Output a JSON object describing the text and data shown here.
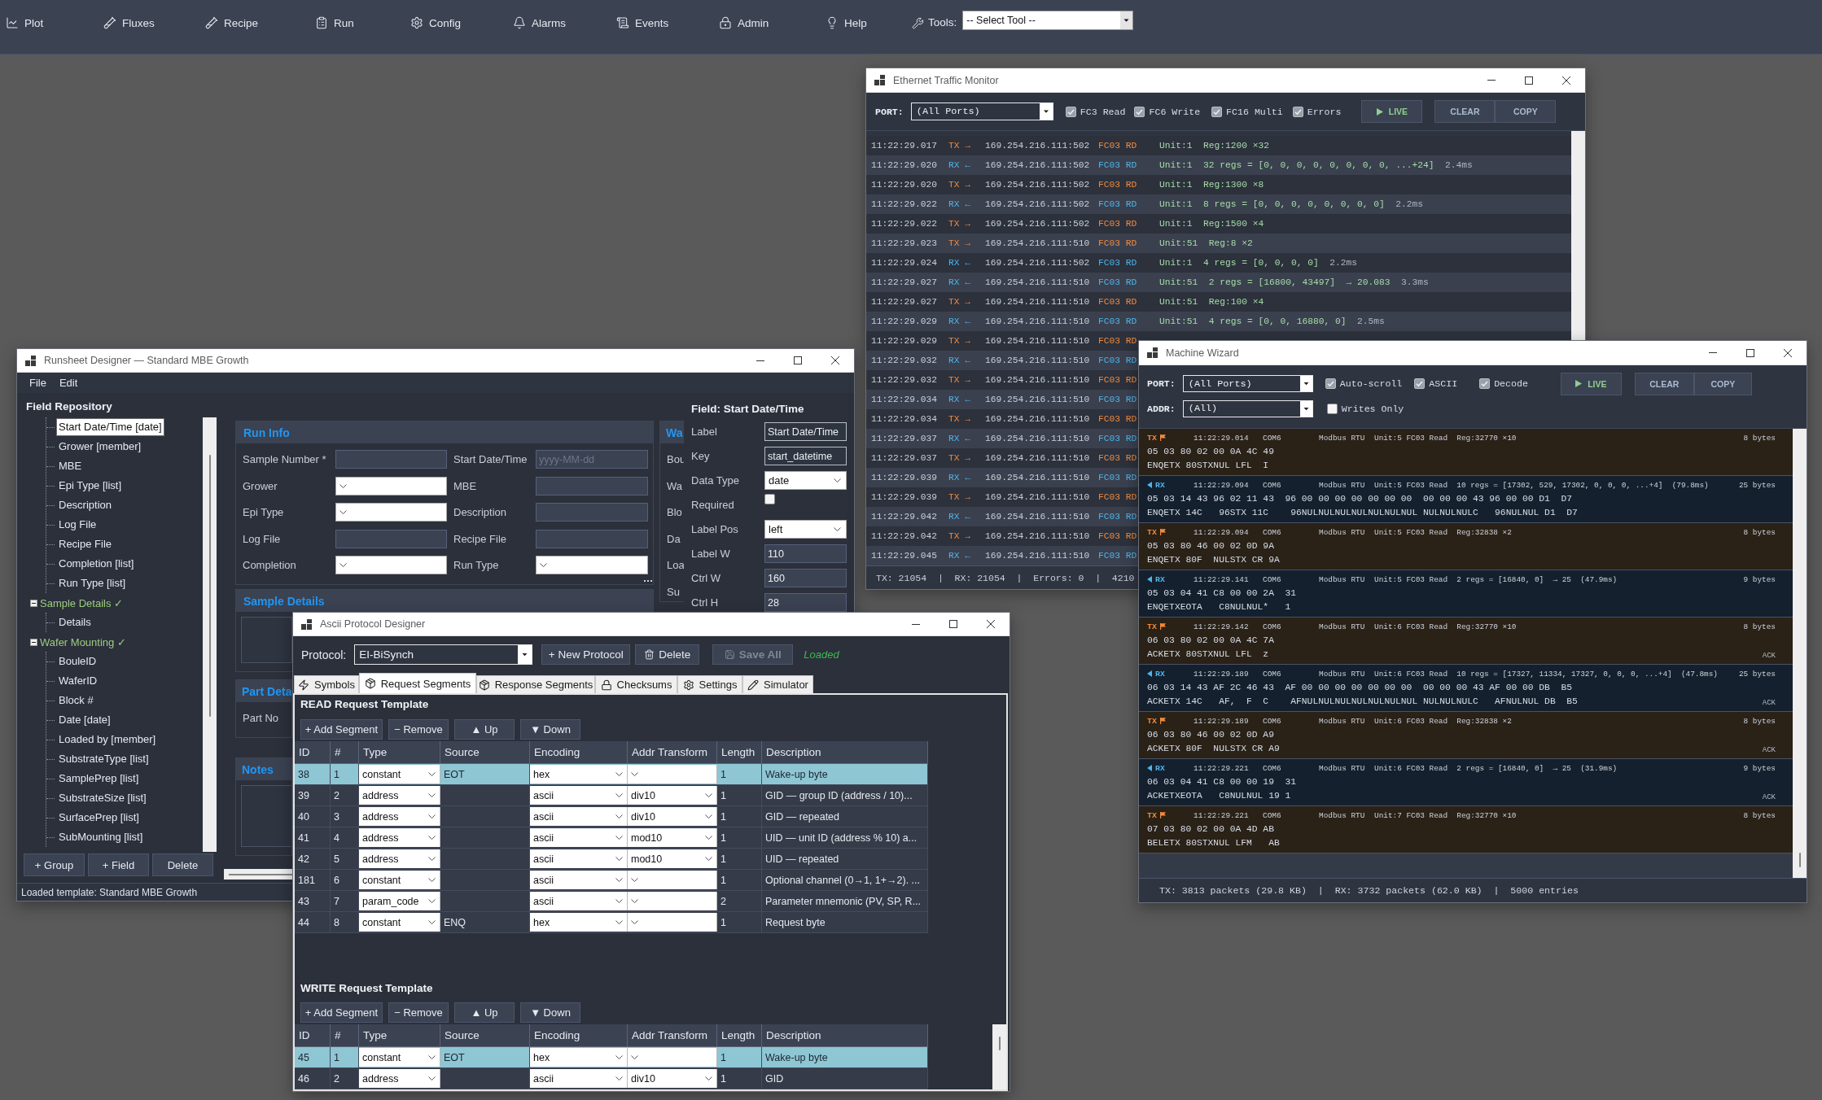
{
  "nav": {
    "items": [
      "Plot",
      "Fluxes",
      "Recipe",
      "Run",
      "Config",
      "Alarms",
      "Events",
      "Admin",
      "Help"
    ],
    "tools_label": "Tools:",
    "tool_select": "-- Select Tool --"
  },
  "ethernet_monitor": {
    "title": "Ethernet Traffic Monitor",
    "port_label": "PORT:",
    "port_select": "(All Ports)",
    "filters": [
      {
        "label": "FC3 Read",
        "checked": true
      },
      {
        "label": "FC6 Write",
        "checked": true
      },
      {
        "label": "FC16 Multi",
        "checked": true
      },
      {
        "label": "Errors",
        "checked": true
      }
    ],
    "buttons": [
      {
        "label": "LIVE",
        "kind": "live"
      },
      {
        "label": "CLEAR",
        "kind": "plain"
      },
      {
        "label": "COPY",
        "kind": "plain"
      }
    ],
    "rows": [
      {
        "kind": "tx",
        "time": "11:22:29.017",
        "direction": "TX →",
        "address": "169.254.216.111:502",
        "function": "FC03 RD",
        "message": "Unit:1  Reg:1200 ×32"
      },
      {
        "kind": "rx",
        "time": "11:22:29.020",
        "direction": "RX ←",
        "address": "169.254.216.111:502",
        "function": "FC03 RD",
        "message": "Unit:1  32 regs = [0, 0, 0, 0, 0, 0, 0, 0, ...+24]",
        "duration": "2.4ms"
      },
      {
        "kind": "tx",
        "time": "11:22:29.020",
        "direction": "TX →",
        "address": "169.254.216.111:502",
        "function": "FC03 RD",
        "message": "Unit:1  Reg:1300 ×8"
      },
      {
        "kind": "rx",
        "time": "11:22:29.022",
        "direction": "RX ←",
        "address": "169.254.216.111:502",
        "function": "FC03 RD",
        "message": "Unit:1  8 regs = [0, 0, 0, 0, 0, 0, 0, 0]",
        "duration": "2.2ms"
      },
      {
        "kind": "tx",
        "time": "11:22:29.022",
        "direction": "TX →",
        "address": "169.254.216.111:502",
        "function": "FC03 RD",
        "message": "Unit:1  Reg:1500 ×4"
      },
      {
        "kind": "tx",
        "time": "11:22:29.023",
        "direction": "TX →",
        "address": "169.254.216.111:510",
        "function": "FC03 RD",
        "message": "Unit:51  Reg:8 ×2"
      },
      {
        "kind": "rx",
        "time": "11:22:29.024",
        "direction": "RX ←",
        "address": "169.254.216.111:502",
        "function": "FC03 RD",
        "message": "Unit:1  4 regs = [0, 0, 0, 0]",
        "duration": "2.2ms"
      },
      {
        "kind": "rx",
        "time": "11:22:29.027",
        "direction": "RX ←",
        "address": "169.254.216.111:510",
        "function": "FC03 RD",
        "message": "Unit:51  2 regs = [16800, 43497]  → 20.083",
        "duration": "3.3ms"
      },
      {
        "kind": "tx",
        "time": "11:22:29.027",
        "direction": "TX →",
        "address": "169.254.216.111:510",
        "function": "FC03 RD",
        "message": "Unit:51  Reg:100 ×4"
      },
      {
        "kind": "rx",
        "time": "11:22:29.029",
        "direction": "RX ←",
        "address": "169.254.216.111:510",
        "function": "FC03 RD",
        "message": "Unit:51  4 regs = [0, 0, 16880, 0]",
        "duration": "2.5ms"
      },
      {
        "kind": "tx",
        "time": "11:22:29.029",
        "direction": "TX →",
        "address": "169.254.216.111:510",
        "function": "FC03 RD"
      },
      {
        "kind": "rx",
        "time": "11:22:29.032",
        "direction": "RX ←",
        "address": "169.254.216.111:510",
        "function": "FC03 RD"
      },
      {
        "kind": "tx",
        "time": "11:22:29.032",
        "direction": "TX →",
        "address": "169.254.216.111:510",
        "function": "FC03 RD"
      },
      {
        "kind": "rx",
        "time": "11:22:29.034",
        "direction": "RX ←",
        "address": "169.254.216.111:510",
        "function": "FC03 RD"
      },
      {
        "kind": "tx",
        "time": "11:22:29.034",
        "direction": "TX →",
        "address": "169.254.216.111:510",
        "function": "FC03 RD"
      },
      {
        "kind": "rx",
        "time": "11:22:29.037",
        "direction": "RX ←",
        "address": "169.254.216.111:510",
        "function": "FC03 RD"
      },
      {
        "kind": "tx",
        "time": "11:22:29.037",
        "direction": "TX →",
        "address": "169.254.216.111:510",
        "function": "FC03 RD"
      },
      {
        "kind": "rx",
        "time": "11:22:29.039",
        "direction": "RX ←",
        "address": "169.254.216.111:510",
        "function": "FC03 RD"
      },
      {
        "kind": "tx",
        "time": "11:22:29.039",
        "direction": "TX →",
        "address": "169.254.216.111:510",
        "function": "FC03 RD"
      },
      {
        "kind": "rx",
        "time": "11:22:29.042",
        "direction": "RX ←",
        "address": "169.254.216.111:510",
        "function": "FC03 RD"
      },
      {
        "kind": "tx",
        "time": "11:22:29.042",
        "direction": "TX →",
        "address": "169.254.216.111:510",
        "function": "FC03 RD"
      },
      {
        "kind": "rx",
        "time": "11:22:29.045",
        "direction": "RX ←",
        "address": "169.254.216.111:510",
        "function": "FC03 RD"
      }
    ],
    "status": "TX: 21054  |  RX: 21054  |  Errors: 0  |  4210"
  },
  "runsheet_designer": {
    "title": "Runsheet Designer — Standard MBE Growth",
    "menu": [
      "File",
      "Edit"
    ],
    "repository": {
      "heading": "Field Repository",
      "tree": [
        {
          "children": [
            {
              "label": "Start Date/Time [date]",
              "selected": true
            },
            {
              "label": "Grower [member]",
              "selected": false
            },
            {
              "label": "MBE",
              "selected": false
            },
            {
              "label": "Epi Type [list]",
              "selected": false
            },
            {
              "label": "Description",
              "selected": false
            },
            {
              "label": "Log File",
              "selected": false
            },
            {
              "label": "Recipe File",
              "selected": false
            },
            {
              "label": "Completion [list]",
              "selected": false
            },
            {
              "label": "Run Type [list]",
              "selected": false
            }
          ]
        },
        {
          "label": "Sample Details ✓",
          "expanded": true,
          "children": [
            {
              "label": "Details",
              "selected": false
            }
          ]
        },
        {
          "label": "Wafer Mounting ✓",
          "expanded": true,
          "children": [
            {
              "label": "BouleID",
              "selected": false
            },
            {
              "label": "WaferID",
              "selected": false
            },
            {
              "label": "Block #",
              "selected": false
            },
            {
              "label": "Date [date]",
              "selected": false
            },
            {
              "label": "Loaded by [member]",
              "selected": false
            },
            {
              "label": "SubstrateType [list]",
              "selected": false
            },
            {
              "label": "SamplePrep [list]",
              "selected": false
            },
            {
              "label": "SubstrateSize [list]",
              "selected": false
            },
            {
              "label": "SurfacePrep [list]",
              "selected": false
            },
            {
              "label": "SubMounting [list]",
              "selected": false
            }
          ]
        }
      ],
      "buttons": [
        "+ Group",
        "+ Field",
        "Delete"
      ]
    },
    "sections": [
      {
        "title": "Run Info",
        "kind": "form",
        "fields": [
          {
            "label": "Sample Number *",
            "kind": "text"
          },
          {
            "label": "Start Date/Time",
            "kind": "text",
            "placeholder": "yyyy-MM-dd"
          },
          {
            "label": "Grower",
            "kind": "select"
          },
          {
            "label": "MBE",
            "kind": "text"
          },
          {
            "label": "Epi Type",
            "kind": "select"
          },
          {
            "label": "Description",
            "kind": "text"
          },
          {
            "label": "Log File",
            "kind": "text"
          },
          {
            "label": "Recipe File",
            "kind": "text"
          },
          {
            "label": "Completion",
            "kind": "select"
          },
          {
            "label": "Run Type",
            "kind": "select"
          }
        ]
      },
      {
        "title": "Sample Details",
        "kind": "box"
      },
      {
        "title": "Part Deta",
        "kind": "form",
        "fields": [
          {
            "label": "Part No"
          }
        ]
      },
      {
        "title": "Notes",
        "kind": "box"
      }
    ],
    "side_section": {
      "title": "Wa",
      "labels": [
        "Bou",
        "Wa",
        "Blo",
        "Da",
        "Loa",
        "Su"
      ]
    },
    "properties": {
      "heading": "Field: Start Date/Time",
      "rows": [
        {
          "label": "Label",
          "kind": "text",
          "value": "Start Date/Time"
        },
        {
          "label": "Key",
          "kind": "text",
          "value": "start_datetime"
        },
        {
          "label": "Data Type",
          "kind": "select",
          "value": "date"
        },
        {
          "label": "Required",
          "kind": "checkbox",
          "checked": false
        },
        {
          "label": "Label Pos",
          "kind": "select",
          "value": "left"
        },
        {
          "label": "Label W",
          "kind": "number",
          "value": "110"
        },
        {
          "label": "Ctrl W",
          "kind": "number",
          "value": "160"
        },
        {
          "label": "Ctrl H",
          "kind": "number",
          "value": "28"
        }
      ]
    },
    "status": "Loaded template: Standard MBE Growth"
  },
  "machine_wizard": {
    "title": "Machine Wizard",
    "port_label": "PORT:",
    "port_select": "(All Ports)",
    "options": [
      {
        "label": "Auto-scroll",
        "checked": true
      },
      {
        "label": "ASCII",
        "checked": true
      },
      {
        "label": "Decode",
        "checked": true
      }
    ],
    "buttons": [
      {
        "label": "LIVE",
        "kind": "live"
      },
      {
        "label": "CLEAR",
        "kind": "plain"
      },
      {
        "label": "COPY",
        "kind": "plain"
      }
    ],
    "addr_label": "ADDR:",
    "addr_select": "(All)",
    "writes_only": {
      "label": "Writes Only",
      "checked": false
    },
    "entries": [
      {
        "kind": "tx",
        "direction": "TX",
        "time": "11:22:29.014",
        "port": "COM6",
        "protocol": "Modbus RTU",
        "summary": "Unit:5 FC03 Read  Reg:32770 ×10",
        "size": "8 bytes",
        "hex": "05 03 80 02 00 0A 4C 49",
        "ascii": "ENQETX 80STXNUL LFL  I"
      },
      {
        "kind": "rx",
        "direction": "RX",
        "time": "11:22:29.094",
        "port": "COM6",
        "protocol": "Modbus RTU",
        "summary": "Unit:5 FC03 Read  10 regs = [17302, 529, 17302, 0, 0, 0, ...+4]  (79.8ms)",
        "size": "25 bytes",
        "hex": "05 03 14 43 96 02 11 43  96 00 00 00 00 00 00 00  00 00 00 43 96 00 00 D1  D7",
        "ascii": "ENQETX 14C   96STX 11C    96NULNULNULNULNULNULNUL NULNULNULC   96NULNUL D1  D7"
      },
      {
        "kind": "tx",
        "direction": "TX",
        "time": "11:22:29.094",
        "port": "COM6",
        "protocol": "Modbus RTU",
        "summary": "Unit:5 FC03 Read  Reg:32838 ×2",
        "size": "8 bytes",
        "hex": "05 03 80 46 00 02 0D 9A",
        "ascii": "ENQETX 80F  NULSTX CR 9A"
      },
      {
        "kind": "rx",
        "direction": "RX",
        "time": "11:22:29.141",
        "port": "COM6",
        "protocol": "Modbus RTU",
        "summary": "Unit:5 FC03 Read  2 regs = [16840, 0]  → 25  (47.9ms)",
        "size": "9 bytes",
        "hex": "05 03 04 41 C8 00 00 2A  31",
        "ascii": "ENQETXEOTA   C8NULNUL*   1"
      },
      {
        "kind": "tx",
        "direction": "TX",
        "time": "11:22:29.142",
        "port": "COM6",
        "protocol": "Modbus RTU",
        "summary": "Unit:6 FC03 Read  Reg:32770 ×10",
        "size": "8 bytes",
        "hex": "06 03 80 02 00 0A 4C 7A",
        "ascii": "ACKETX 80STXNUL LFL  z",
        "ack": "ACK"
      },
      {
        "kind": "rx",
        "direction": "RX",
        "time": "11:22:29.189",
        "port": "COM6",
        "protocol": "Modbus RTU",
        "summary": "Unit:6 FC03 Read  10 regs = [17327, 11334, 17327, 0, 0, 0, ...+4]  (47.8ms)",
        "size": "25 bytes",
        "hex": "06 03 14 43 AF 2C 46 43  AF 00 00 00 00 00 00 00  00 00 00 43 AF 00 00 DB  B5",
        "ascii": "ACKETX 14C   AF,  F  C    AFNULNULNULNULNULNULNUL NULNULNULC   AFNULNUL DB  B5",
        "ack": "ACK"
      },
      {
        "kind": "tx",
        "direction": "TX",
        "time": "11:22:29.189",
        "port": "COM6",
        "protocol": "Modbus RTU",
        "summary": "Unit:6 FC03 Read  Reg:32838 ×2",
        "size": "8 bytes",
        "hex": "06 03 80 46 00 02 0D A9",
        "ascii": "ACKETX 80F  NULSTX CR A9",
        "ack": "ACK"
      },
      {
        "kind": "rx",
        "direction": "RX",
        "time": "11:22:29.221",
        "port": "COM6",
        "protocol": "Modbus RTU",
        "summary": "Unit:6 FC03 Read  2 regs = [16840, 0]  → 25  (31.9ms)",
        "size": "9 bytes",
        "hex": "06 03 04 41 C8 00 00 19  31",
        "ascii": "ACKETXEOTA   C8NULNUL 19 1",
        "ack": "ACK"
      },
      {
        "kind": "tx",
        "direction": "TX",
        "time": "11:22:29.221",
        "port": "COM6",
        "protocol": "Modbus RTU",
        "summary": "Unit:7 FC03 Read  Reg:32770 ×10",
        "size": "8 bytes",
        "hex": "07 03 80 02 00 0A 4D AB",
        "ascii": "BELETX 80STXNUL LFM   AB"
      }
    ],
    "status": "TX: 3813 packets (29.8 KB)  |  RX: 3732 packets (62.0 KB)  |  5000 entries"
  },
  "ascii_protocol_designer": {
    "title": "Ascii Protocol Designer",
    "protocol_label": "Protocol:",
    "protocol_select": "EI-BiSynch",
    "buttons": [
      {
        "label": "+ New Protocol",
        "kind": "plain",
        "disabled": false
      },
      {
        "label": "Delete",
        "kind": "delete",
        "disabled": false
      },
      {
        "label": "Save All",
        "kind": "save",
        "disabled": true
      }
    ],
    "status": "Loaded",
    "tabs": [
      {
        "label": "Symbols",
        "selected": false
      },
      {
        "label": "Request Segments",
        "selected": true
      },
      {
        "label": "Response Segments",
        "selected": false
      },
      {
        "label": "Checksums",
        "selected": false
      },
      {
        "label": "Settings",
        "selected": false
      },
      {
        "label": "Simulator",
        "selected": false
      }
    ],
    "templates": [
      {
        "title": "READ Request Template",
        "buttons": [
          "+ Add Segment",
          "− Remove",
          "▲ Up",
          "▼ Down"
        ],
        "columns": [
          "ID",
          "#",
          "Type",
          "Source",
          "Encoding",
          "Addr Transform",
          "Length",
          "Description"
        ],
        "rows": [
          {
            "id": "38",
            "index": "1",
            "type": "constant",
            "source": "EOT",
            "encoding": "hex",
            "length": "1",
            "description": "Wake-up byte",
            "selected": true
          },
          {
            "id": "39",
            "index": "2",
            "type": "address",
            "encoding": "ascii",
            "transform": "div10",
            "length": "1",
            "description": "GID — group ID (address / 10)...",
            "selected": false
          },
          {
            "id": "40",
            "index": "3",
            "type": "address",
            "encoding": "ascii",
            "transform": "div10",
            "length": "1",
            "description": "GID — repeated",
            "selected": false
          },
          {
            "id": "41",
            "index": "4",
            "type": "address",
            "encoding": "ascii",
            "transform": "mod10",
            "length": "1",
            "description": "UID — unit ID (address % 10) a...",
            "selected": false
          },
          {
            "id": "42",
            "index": "5",
            "type": "address",
            "encoding": "ascii",
            "transform": "mod10",
            "length": "1",
            "description": "UID — repeated",
            "selected": false
          },
          {
            "id": "181",
            "index": "6",
            "type": "constant",
            "encoding": "ascii",
            "length": "1",
            "description": "Optional channel (0→1, 1+→2). ...",
            "selected": false
          },
          {
            "id": "43",
            "index": "7",
            "type": "param_code",
            "encoding": "ascii",
            "length": "2",
            "description": "Parameter mnemonic (PV, SP, R...",
            "selected": false
          },
          {
            "id": "44",
            "index": "8",
            "type": "constant",
            "source": "ENQ",
            "encoding": "hex",
            "length": "1",
            "description": "Request byte",
            "selected": false
          }
        ]
      },
      {
        "title": "WRITE Request Template",
        "buttons": [
          "+ Add Segment",
          "− Remove",
          "▲ Up",
          "▼ Down"
        ],
        "columns": [
          "ID",
          "#",
          "Type",
          "Source",
          "Encoding",
          "Addr Transform",
          "Length",
          "Description"
        ],
        "rows": [
          {
            "id": "45",
            "index": "1",
            "type": "constant",
            "source": "EOT",
            "encoding": "hex",
            "length": "1",
            "description": "Wake-up byte",
            "selected": true
          },
          {
            "id": "46",
            "index": "2",
            "type": "address",
            "encoding": "ascii",
            "transform": "div10",
            "length": "1",
            "description": "GID",
            "selected": false
          }
        ]
      }
    ]
  }
}
